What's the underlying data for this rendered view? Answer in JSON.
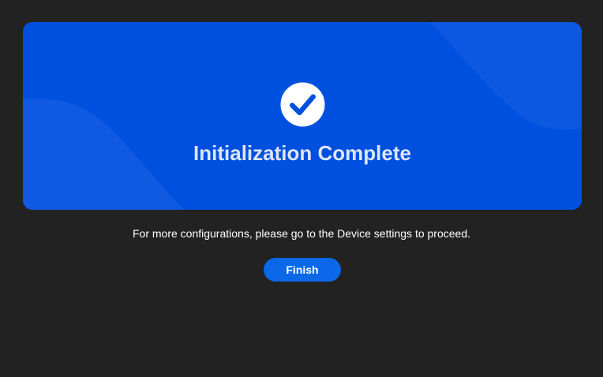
{
  "banner": {
    "title": "Initialization Complete",
    "icon": "check-circle-icon",
    "color": "#0050e0"
  },
  "message": "For more configurations, please go to the Device settings to proceed.",
  "actions": {
    "finish_label": "Finish",
    "finish_color": "#0b68e8"
  },
  "colors": {
    "background": "#222222"
  }
}
